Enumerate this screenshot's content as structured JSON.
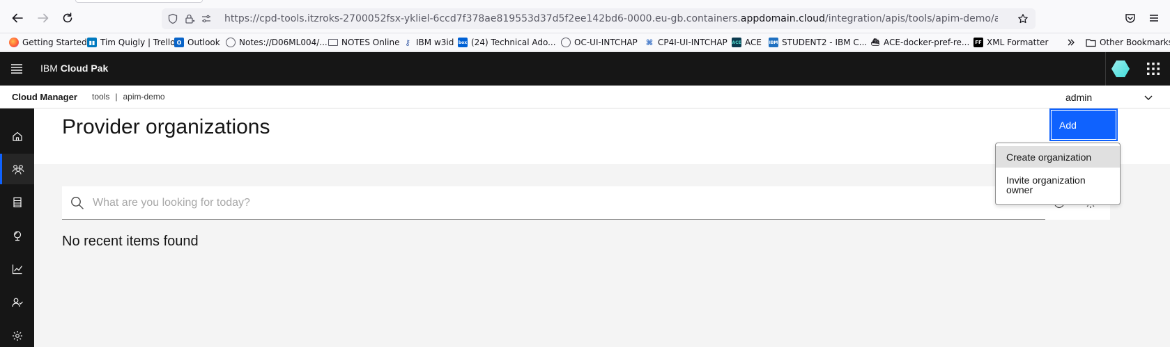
{
  "browser": {
    "url_prefix": "https://cpd-tools.itzroks-2700052fsx-ykliel-6ccd7f378ae819553d37d5f2ee142bd6-0000.eu-gb.containers.",
    "url_domain": "appdomain.cloud",
    "url_suffix": "/integration/apis/tools/apim-demo/admin/provider-or"
  },
  "bookmarks": {
    "items": [
      {
        "label": "Getting Started",
        "icon": "firefox-icon"
      },
      {
        "label": "Tim Quigly | Trello",
        "icon": "trello-icon"
      },
      {
        "label": "Outlook",
        "icon": "outlook-icon"
      },
      {
        "label": "Notes://D06ML004/...",
        "icon": "globe-icon"
      },
      {
        "label": "NOTES Online",
        "icon": "mail-icon"
      },
      {
        "label": "IBM w3id",
        "icon": "key-icon"
      },
      {
        "label": "(24) Technical Ado...",
        "icon": "box-icon"
      },
      {
        "label": "OC-UI-INTCHAP",
        "icon": "globe-icon"
      },
      {
        "label": "CP4I-UI-INTCHAP",
        "icon": "cp4i-icon"
      },
      {
        "label": "ACE",
        "icon": "ace-icon"
      },
      {
        "label": "STUDENT2 - IBM C...",
        "icon": "ibm-icon"
      },
      {
        "label": "ACE-docker-pref-re...",
        "icon": "docker-icon"
      },
      {
        "label": "XML Formatter",
        "icon": "ff-icon"
      }
    ],
    "other_label": "Other Bookmarks"
  },
  "header": {
    "brand_prefix": "IBM ",
    "brand_name": "Cloud Pak"
  },
  "subheader": {
    "product": "Cloud Manager",
    "breadcrumb_1": "tools",
    "separator": "|",
    "breadcrumb_2": "apim-demo",
    "user": "admin"
  },
  "sidenav": {
    "items": [
      "home-icon",
      "provider-orgs-icon",
      "resources-icon",
      "topology-icon",
      "analytics-icon",
      "members-icon",
      "settings-icon"
    ],
    "active_index": 1
  },
  "main": {
    "title": "Provider organizations",
    "add_label": "Add",
    "search_placeholder": "What are you looking for today?",
    "empty_text": "No recent items found"
  },
  "add_menu": {
    "items": [
      "Create organization",
      "Invite organization owner"
    ]
  },
  "colors": {
    "accent": "#0f62fe",
    "header_bg": "#161616",
    "page_bg": "#f4f4f4"
  }
}
